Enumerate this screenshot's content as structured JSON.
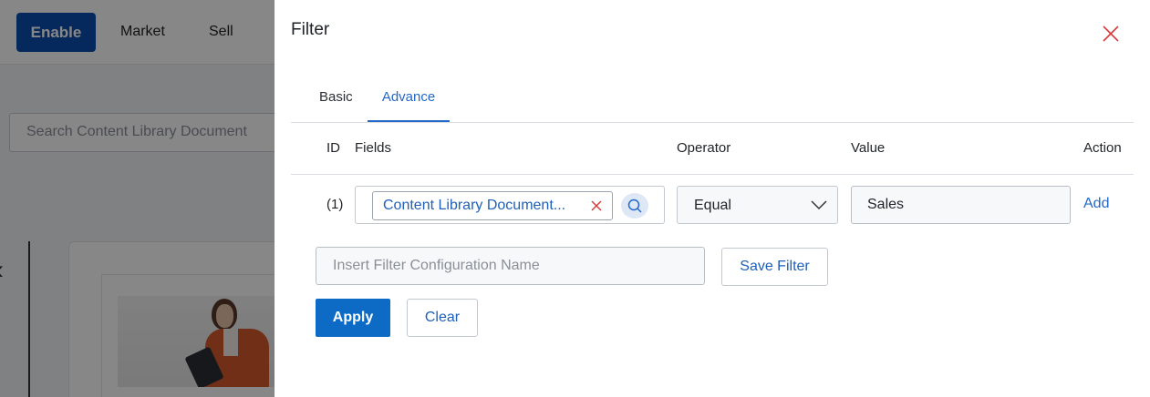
{
  "background": {
    "enable_label": "Enable",
    "nav": [
      "Market",
      "Sell"
    ],
    "search_placeholder": "Search Content Library Document"
  },
  "filter": {
    "title": "Filter",
    "tabs": [
      {
        "label": "Basic",
        "active": false
      },
      {
        "label": "Advance",
        "active": true
      }
    ],
    "columns": {
      "id": "ID",
      "fields": "Fields",
      "operator": "Operator",
      "value": "Value",
      "action": "Action"
    },
    "row": {
      "id": "(1)",
      "field": "Content Library Document...",
      "operator": "Equal",
      "value": "Sales",
      "action": "Add"
    },
    "config_placeholder": "Insert Filter Configuration Name",
    "save_filter_label": "Save Filter",
    "apply_label": "Apply",
    "clear_label": "Clear"
  },
  "colors": {
    "accent": "#2468c8",
    "primary_button": "#0d6bc6",
    "enable_button": "#0a4fae",
    "close_icon": "#d83a3a"
  },
  "icons": [
    "close-icon",
    "remove-chip-icon",
    "search-icon",
    "chevron-down-icon"
  ]
}
